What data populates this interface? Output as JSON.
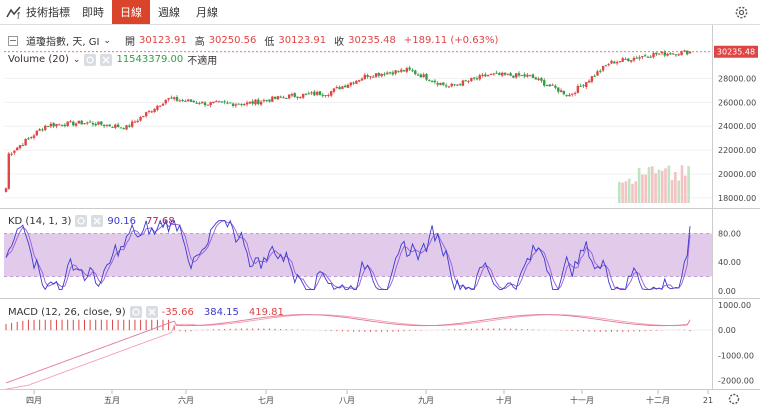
{
  "toolbar": {
    "title": "技術指標",
    "tabs": [
      {
        "label": "即時",
        "active": false
      },
      {
        "label": "日線",
        "active": true
      },
      {
        "label": "週線",
        "active": false
      },
      {
        "label": "月線",
        "active": false
      }
    ]
  },
  "main_legend": {
    "symbol": "道瓊指數, 天, GI",
    "open_label": "開",
    "open": "30123.91",
    "high_label": "高",
    "high": "30250.56",
    "low_label": "低",
    "low": "30123.91",
    "close_label": "收",
    "close": "30235.48",
    "change": "+189.11 (+0.63%)",
    "last_price_tag": "30235.48"
  },
  "volume_legend": {
    "label": "Volume (20)",
    "value": "11543379.00",
    "na": "不適用"
  },
  "kd_legend": {
    "label": "KD (14, 1, 3)",
    "k": "90.16",
    "d": "77.68"
  },
  "macd_legend": {
    "label": "MACD (12, 26, close, 9)",
    "hist": "-35.66",
    "macd": "384.15",
    "signal": "419.81"
  },
  "colors": {
    "up": "#e04545",
    "down": "#2f9e44",
    "k_line": "#3a3ad0",
    "d_line": "#9a5ad8",
    "kd_band": "#d8b8e4",
    "macd_line": "#e07a9a",
    "signal_line": "#f4a0b0",
    "hist": "#e04545",
    "price_tag": "#e04545",
    "accent": "#d9442b"
  },
  "x_axis": {
    "months": [
      "四月",
      "五月",
      "六月",
      "七月",
      "八月",
      "九月",
      "十月",
      "十一月",
      "十二月",
      "21"
    ]
  },
  "chart_data": [
    {
      "type": "candlestick",
      "title": "道瓊指數, 天, GI",
      "x_labels": [
        "四月",
        "五月",
        "六月",
        "七月",
        "八月",
        "九月",
        "十月",
        "十一月",
        "十二月",
        "21"
      ],
      "y_ticks": [
        "28000.00",
        "26000.00",
        "24000.00",
        "22000.00",
        "20000.00",
        "18000.00"
      ],
      "ylim": [
        17400,
        30800
      ],
      "close_series": [
        {
          "month": "四月",
          "close": 21500
        },
        {
          "month": "四月末",
          "close": 24100
        },
        {
          "month": "五月",
          "close": 24300
        },
        {
          "month": "五月末",
          "close": 23900
        },
        {
          "month": "六月",
          "close": 26300
        },
        {
          "month": "六月末",
          "close": 25900
        },
        {
          "month": "七月",
          "close": 25900
        },
        {
          "month": "七月末",
          "close": 26500
        },
        {
          "month": "八月",
          "close": 26800
        },
        {
          "month": "八月末",
          "close": 28300
        },
        {
          "month": "九月",
          "close": 28700
        },
        {
          "month": "九月末",
          "close": 27300
        },
        {
          "month": "十月",
          "close": 28300
        },
        {
          "month": "十月末",
          "close": 28200
        },
        {
          "month": "十一月",
          "close": 26600
        },
        {
          "month": "十一月中",
          "close": 29300
        },
        {
          "month": "十二月",
          "close": 30000
        },
        {
          "month": "十二月末",
          "close": 30235.48
        }
      ]
    },
    {
      "type": "line",
      "title": "KD (14, 1, 3)",
      "y_ticks": [
        "80.00",
        "40.00",
        "0.00"
      ],
      "ylim": [
        -10,
        110
      ],
      "band": [
        20,
        80
      ],
      "series": [
        {
          "name": "K",
          "last": 90.16
        },
        {
          "name": "D",
          "last": 77.68
        }
      ]
    },
    {
      "type": "line",
      "title": "MACD (12, 26, close, 9)",
      "y_ticks": [
        "1000.00",
        "0.00",
        "-1000.00",
        "-2000.00"
      ],
      "ylim": [
        -2300,
        1200
      ],
      "series": [
        {
          "name": "MACD",
          "last": 384.15
        },
        {
          "name": "Signal",
          "last": 419.81
        },
        {
          "name": "Histogram",
          "last": -35.66
        }
      ]
    }
  ]
}
